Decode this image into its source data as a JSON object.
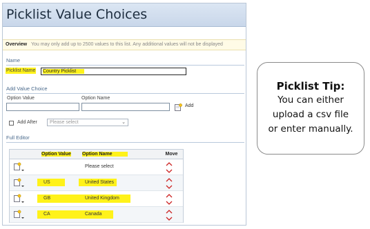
{
  "page_title": "Picklist Value Choices",
  "overview": {
    "label": "Overview",
    "text": "You may only add up to 2500 values to this list. Any additional values will not be displayed"
  },
  "name_section": {
    "heading": "Name",
    "picklist_name_label": "Picklist Name",
    "picklist_name_value": "Country Picklist"
  },
  "add_value_choice": {
    "heading": "Add Value Choice",
    "option_value_label": "Option Value",
    "option_name_label": "Option Name",
    "add_label": "Add",
    "add_after_label": "Add After",
    "add_after_placeholder": "Please select"
  },
  "full_editor": {
    "heading": "Full Editor",
    "columns": [
      "Option Value",
      "Option Name",
      "Move"
    ],
    "rows": [
      {
        "value": "",
        "name": "Please select"
      },
      {
        "value": "US",
        "name": "United States"
      },
      {
        "value": "GB",
        "name": "United Kingdom"
      },
      {
        "value": "CA",
        "name": "Canada"
      }
    ]
  },
  "tip": {
    "title": "Picklist Tip:",
    "lines": [
      "You can either",
      "upload a csv file",
      "or enter manually."
    ]
  },
  "colors": {
    "highlight": "#fff21a",
    "title_bar": "#d3e0f0",
    "section_heading": "#4a6a8c",
    "arrow_red": "#cc2222"
  },
  "icons": [
    "add-note-icon",
    "dropdown-caret-icon",
    "move-up-icon",
    "move-down-icon"
  ]
}
